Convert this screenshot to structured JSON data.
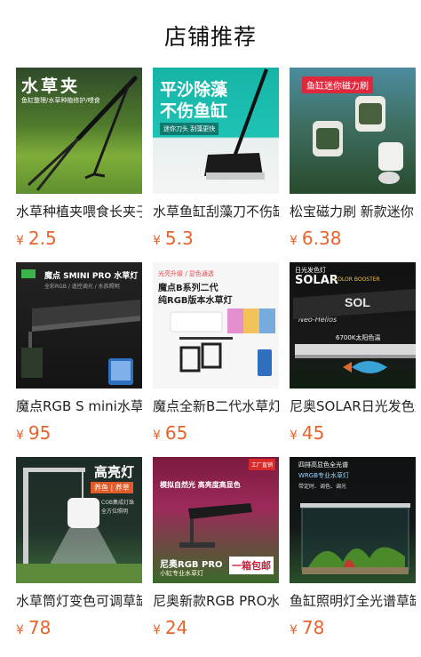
{
  "header": {
    "title": "店铺推荐"
  },
  "currency": "¥",
  "products": [
    {
      "title": "水草种植夹喂食长夹子",
      "price": "2.5",
      "image": {
        "headline": "水草夹",
        "sub": "鱼缸整理/水草种植修护/喂食"
      }
    },
    {
      "title": "水草鱼缸刮藻刀不伤缸",
      "price": "5.3",
      "image": {
        "headline1": "平沙除藻",
        "headline2": "不伤鱼缸",
        "tag": "迷你刀头 刮藻更快"
      }
    },
    {
      "title": "松宝磁力刷 新款迷你",
      "price": "6.38",
      "image": {
        "headline": "鱼缸迷你磁力刷"
      }
    },
    {
      "title": "魔点RGB S  mini水草灯",
      "price": "95",
      "image": {
        "headline": "魔点 SMINI PRO 水草灯",
        "sub": "全彩RGB / 遥控调光 / 水族照明"
      }
    },
    {
      "title": "魔点全新B二代水草灯",
      "price": "65",
      "image": {
        "tag": "光亮升级 / 显色通透",
        "headline1": "魔点B系列二代",
        "headline2": "纯RGB版本水草灯"
      }
    },
    {
      "title": "尼奥SOLAR日光发色灯",
      "price": "45",
      "image": {
        "tag": "日光发色灯",
        "brand": "SOLAR",
        "brand_sub": "COLOR BOOSTER",
        "maker": "Neo-Helios",
        "spec": "6700K太阳色温"
      }
    },
    {
      "title": "水草筒灯变色可调草缸",
      "price": "78",
      "image": {
        "headline": "高亮灯",
        "tag": "养鱼 | 养草",
        "desc1": "COB集成灯珠",
        "desc2": "全方位照明"
      }
    },
    {
      "title": "尼奥新款RGB PRO水草灯",
      "price": "24",
      "image": {
        "headline": "模拟自然光 高亮度高显色",
        "corner": "工厂直销",
        "brand": "尼奥RGB PRO",
        "brand_sub": "小缸专业水草灯",
        "badge": "一箱包邮"
      }
    },
    {
      "title": "鱼缸照明灯全光谱草缸",
      "price": "78",
      "image": {
        "headline": "四排高显色全光谱",
        "sub1": "WRGB专业水草灯",
        "sub2": "带定时、调色、调光"
      }
    }
  ]
}
